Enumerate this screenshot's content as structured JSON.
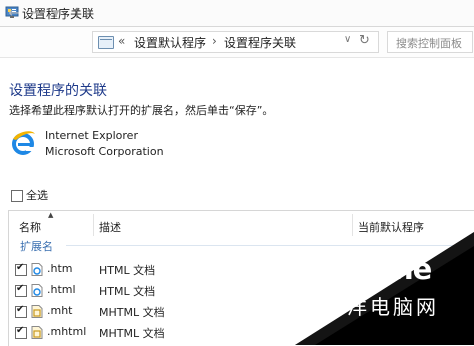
{
  "window": {
    "title": "设置程序关联"
  },
  "nav": {
    "back_icon": "arrow-left-icon",
    "forward_icon": "arrow-right-icon",
    "recent_icon": "chevron-down-icon",
    "up_icon": "arrow-up-icon"
  },
  "address": {
    "separator": "«",
    "crumbs": [
      "设置默认程序",
      "设置程序关联"
    ],
    "crumb_separator": "›",
    "dropdown_icon": "chevron-down-icon",
    "refresh_icon": "refresh-icon"
  },
  "search": {
    "placeholder": "搜索控制面板"
  },
  "content": {
    "heading": "设置程序的关联",
    "subtext": "选择希望此程序默认打开的扩展名，然后单击“保存”。",
    "app": {
      "name": "Internet Explorer",
      "company": "Microsoft Corporation"
    },
    "select_all_label": "全选"
  },
  "table": {
    "columns": [
      "名称",
      "描述",
      "当前默认程序"
    ],
    "group": "扩展名",
    "rows": [
      {
        "name": ".htm",
        "desc": "HTML 文档",
        "checked": true,
        "icon": "ie-file-icon"
      },
      {
        "name": ".html",
        "desc": "HTML 文档",
        "checked": true,
        "icon": "ie-file-icon"
      },
      {
        "name": ".mht",
        "desc": "MHTML 文档",
        "checked": true,
        "icon": "mht-file-icon"
      },
      {
        "name": ".mhtml",
        "desc": "MHTML 文档",
        "checked": true,
        "icon": "mht-file-icon"
      }
    ]
  },
  "watermark": {
    "line1": "PConline",
    "line2": "太平洋电脑网"
  },
  "colors": {
    "heading": "#1e3a8a",
    "group_label": "#3a6fb0",
    "corner": "#000000"
  }
}
